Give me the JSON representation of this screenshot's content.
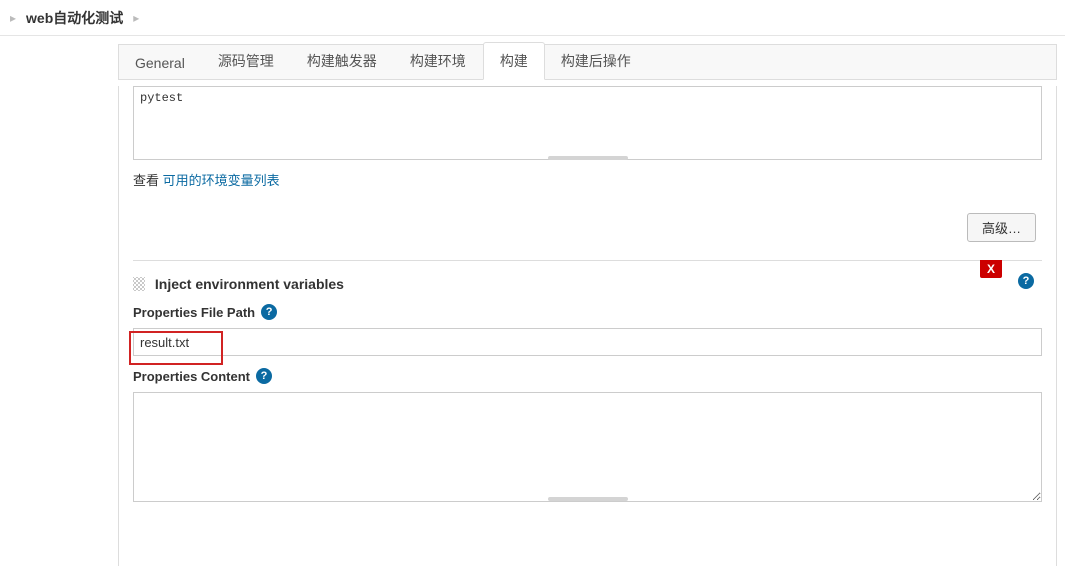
{
  "breadcrumb": {
    "title": "web自动化测试"
  },
  "tabs": [
    {
      "label": "General",
      "active": false
    },
    {
      "label": "源码管理",
      "active": false
    },
    {
      "label": "构建触发器",
      "active": false
    },
    {
      "label": "构建环境",
      "active": false
    },
    {
      "label": "构建",
      "active": true
    },
    {
      "label": "构建后操作",
      "active": false
    }
  ],
  "build_step_shell": {
    "content": "pytest",
    "env_hint_prefix": "查看 ",
    "env_hint_link": "可用的环境变量列表"
  },
  "buttons": {
    "advanced": "高级…"
  },
  "inject_section": {
    "title": "Inject environment variables",
    "delete_label": "X",
    "file_path_label": "Properties File Path",
    "file_path_value": "result.txt",
    "content_label": "Properties Content",
    "content_value": ""
  },
  "help_glyph": "?"
}
